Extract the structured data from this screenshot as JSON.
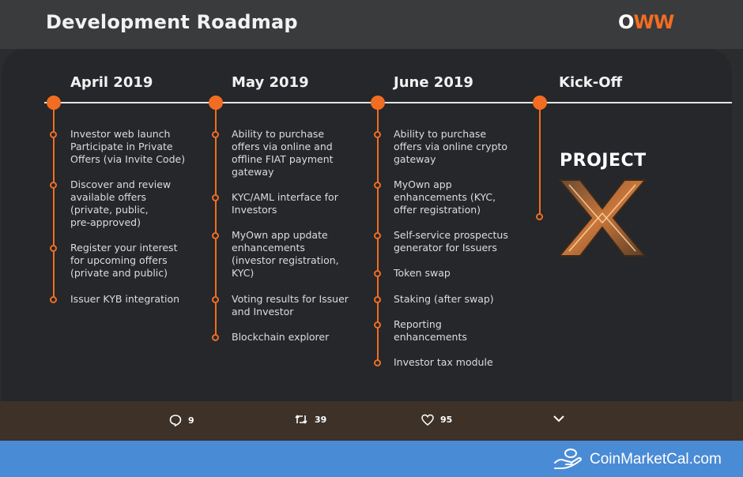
{
  "header": {
    "title": "Development Roadmap",
    "logo_text_a": "O",
    "logo_text_b": "W",
    "logo_text_c": "W"
  },
  "columns": [
    {
      "heading": "April 2019",
      "items": [
        "Investor web launch\nParticipate in Private\nOffers (via Invite Code)",
        "Discover and review\navailable offers\n(private, public,\npre-approved)",
        "Register your interest\nfor upcoming offers\n(private and public)",
        "Issuer KYB integration"
      ]
    },
    {
      "heading": "May 2019",
      "items": [
        "Ability to purchase\noffers via online and\noffline FIAT payment\ngateway",
        "KYC/AML interface for\nInvestors",
        "MyOwn app update\nenhancements\n(investor registration,\nKYC)",
        "Voting results for Issuer\nand Investor",
        "Blockchain explorer"
      ]
    },
    {
      "heading": "June 2019",
      "items": [
        "Ability to purchase\noffers via online crypto\ngateway",
        "MyOwn app\nenhancements (KYC,\noffer registration)",
        "Self-service prospectus\ngenerator for Issuers",
        "Token swap",
        "Staking (after swap)",
        "Reporting\nenhancements",
        "Investor tax module"
      ]
    },
    {
      "heading": "Kick-Off",
      "project_title": "PROJECT"
    }
  ],
  "actions": {
    "reply_count": "9",
    "retweet_count": "39",
    "like_count": "95"
  },
  "footer": {
    "brand": "CoinMarketCal.com"
  },
  "colors": {
    "accent": "#f26d21",
    "panel": "#25272a",
    "footer": "#4a8bd6"
  }
}
